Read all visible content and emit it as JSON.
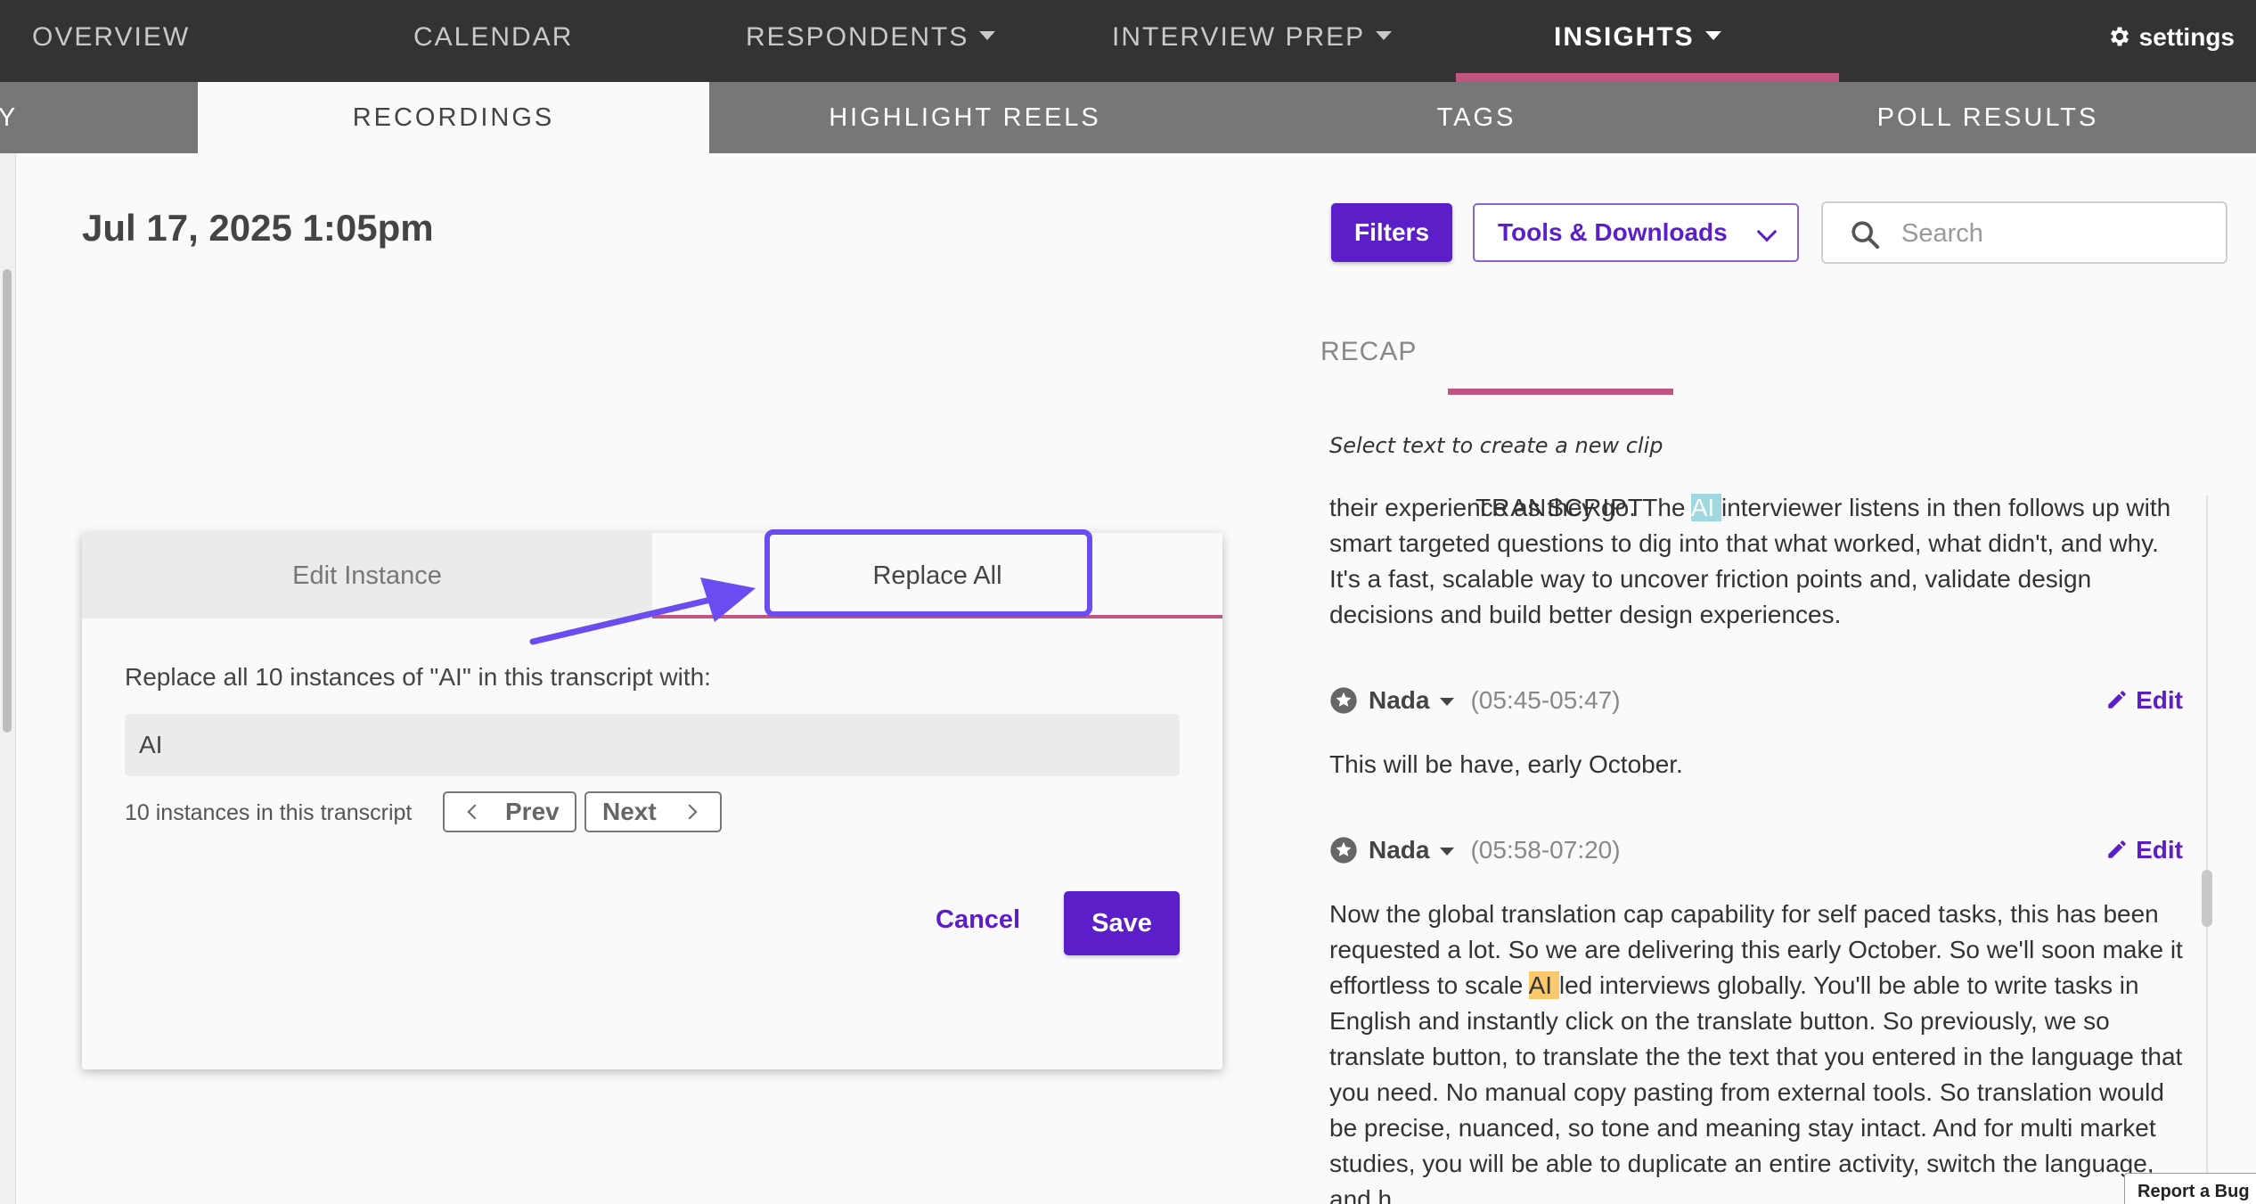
{
  "topnav": {
    "items": [
      "OVERVIEW",
      "CALENDAR",
      "RESPONDENTS",
      "INTERVIEW PREP",
      "INSIGHTS"
    ],
    "settings_label": "settings"
  },
  "subnav": {
    "tabs": [
      "Y",
      "RECORDINGS",
      "HIGHLIGHT REELS",
      "TAGS",
      "POLL RESULTS"
    ]
  },
  "recording": {
    "date": "Jul 17, 2025 1:05pm"
  },
  "toolbar": {
    "filters_label": "Filters",
    "tools_label": "Tools & Downloads",
    "search_placeholder": "Search"
  },
  "panel_tabs": {
    "recap": "RECAP",
    "transcript": "TRANSCRIPT"
  },
  "hint": "Select text to create a new clip",
  "transcript": {
    "block0": {
      "before": "their experience as they go. The ",
      "highlight": "AI ",
      "after": "interviewer listens in then follows up with smart targeted questions to dig into that what worked, what didn't, and why. It's a fast, scalable way to uncover friction points and, validate design decisions and build better design experiences."
    },
    "entries": [
      {
        "speaker": "Nada",
        "time": "(05:45-05:47)",
        "edit_label": "Edit",
        "text": "This will be have, early October."
      },
      {
        "speaker": "Nada",
        "time": "(05:58-07:20)",
        "edit_label": "Edit",
        "before": "Now the global translation cap capability for self paced tasks, this has been requested a lot. So we are delivering this early October. So we'll soon make it effortless to scale ",
        "highlight": "AI ",
        "after": "led interviews globally. You'll be able to write tasks in English and instantly click on the translate button. So previously, we so translate button, to translate the the text that you entered in the language that you need. No manual copy pasting from external tools. So translation would be precise, nuanced, so tone and meaning stay intact. And for multi market studies, you will be able to duplicate an entire activity, switch the language, and h"
      }
    ]
  },
  "modal": {
    "tab_edit": "Edit Instance",
    "tab_replace": "Replace All",
    "prompt": "Replace all 10 instances of \"AI\" in this transcript with:",
    "replace_value": "AI",
    "count_text": "10 instances in this transcript",
    "prev_label": "Prev",
    "next_label": "Next",
    "cancel_label": "Cancel",
    "save_label": "Save"
  },
  "report_bug_label": "Report a Bug",
  "colors": {
    "accent_purple": "#5b1ec8",
    "accent_pink": "#c2557f",
    "annotation": "#6a4cf0",
    "nav_dark": "#333333",
    "subnav_gray": "#777777"
  }
}
